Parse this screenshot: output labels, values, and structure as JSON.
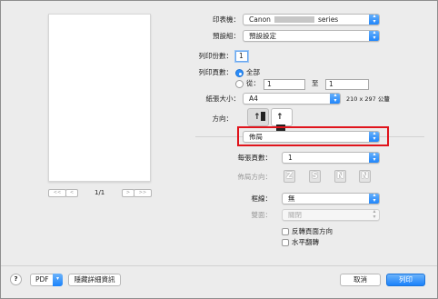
{
  "printer": {
    "label": "印表機：",
    "value": "Canon",
    "suffix": "series"
  },
  "presets": {
    "label": "預設組：",
    "value": "預設設定"
  },
  "copies": {
    "label": "列印份數：",
    "value": "1"
  },
  "pages": {
    "label": "列印頁數：",
    "all": "全部",
    "from": "從：",
    "from_value": "1",
    "to": "至",
    "to_value": "1"
  },
  "paper_size": {
    "label": "紙張大小：",
    "value": "A4",
    "dimensions": "210 x 297 公釐"
  },
  "orientation": {
    "label": "方向："
  },
  "section": {
    "value": "佈局"
  },
  "layout": {
    "pages_per_sheet_label": "每張頁數：",
    "pages_per_sheet_value": "1",
    "direction_label": "佈局方向：",
    "direction_glyphs": [
      "Z",
      "S",
      "N",
      "N"
    ],
    "border_label": "框線：",
    "border_value": "無",
    "two_sided_label": "雙面：",
    "two_sided_value": "關閉",
    "reverse_label": "反轉頁面方向",
    "flip_label": "水平翻轉"
  },
  "preview": {
    "page_indicator": "1/1",
    "nav": [
      "<<",
      "<",
      ">",
      ">>"
    ]
  },
  "footer": {
    "help": "?",
    "pdf": "PDF",
    "hide_details": "隱藏詳細資訊",
    "cancel": "取消",
    "print": "列印"
  },
  "colors": {
    "accent": "#1a82fb",
    "highlight_box": "#e0141c"
  }
}
